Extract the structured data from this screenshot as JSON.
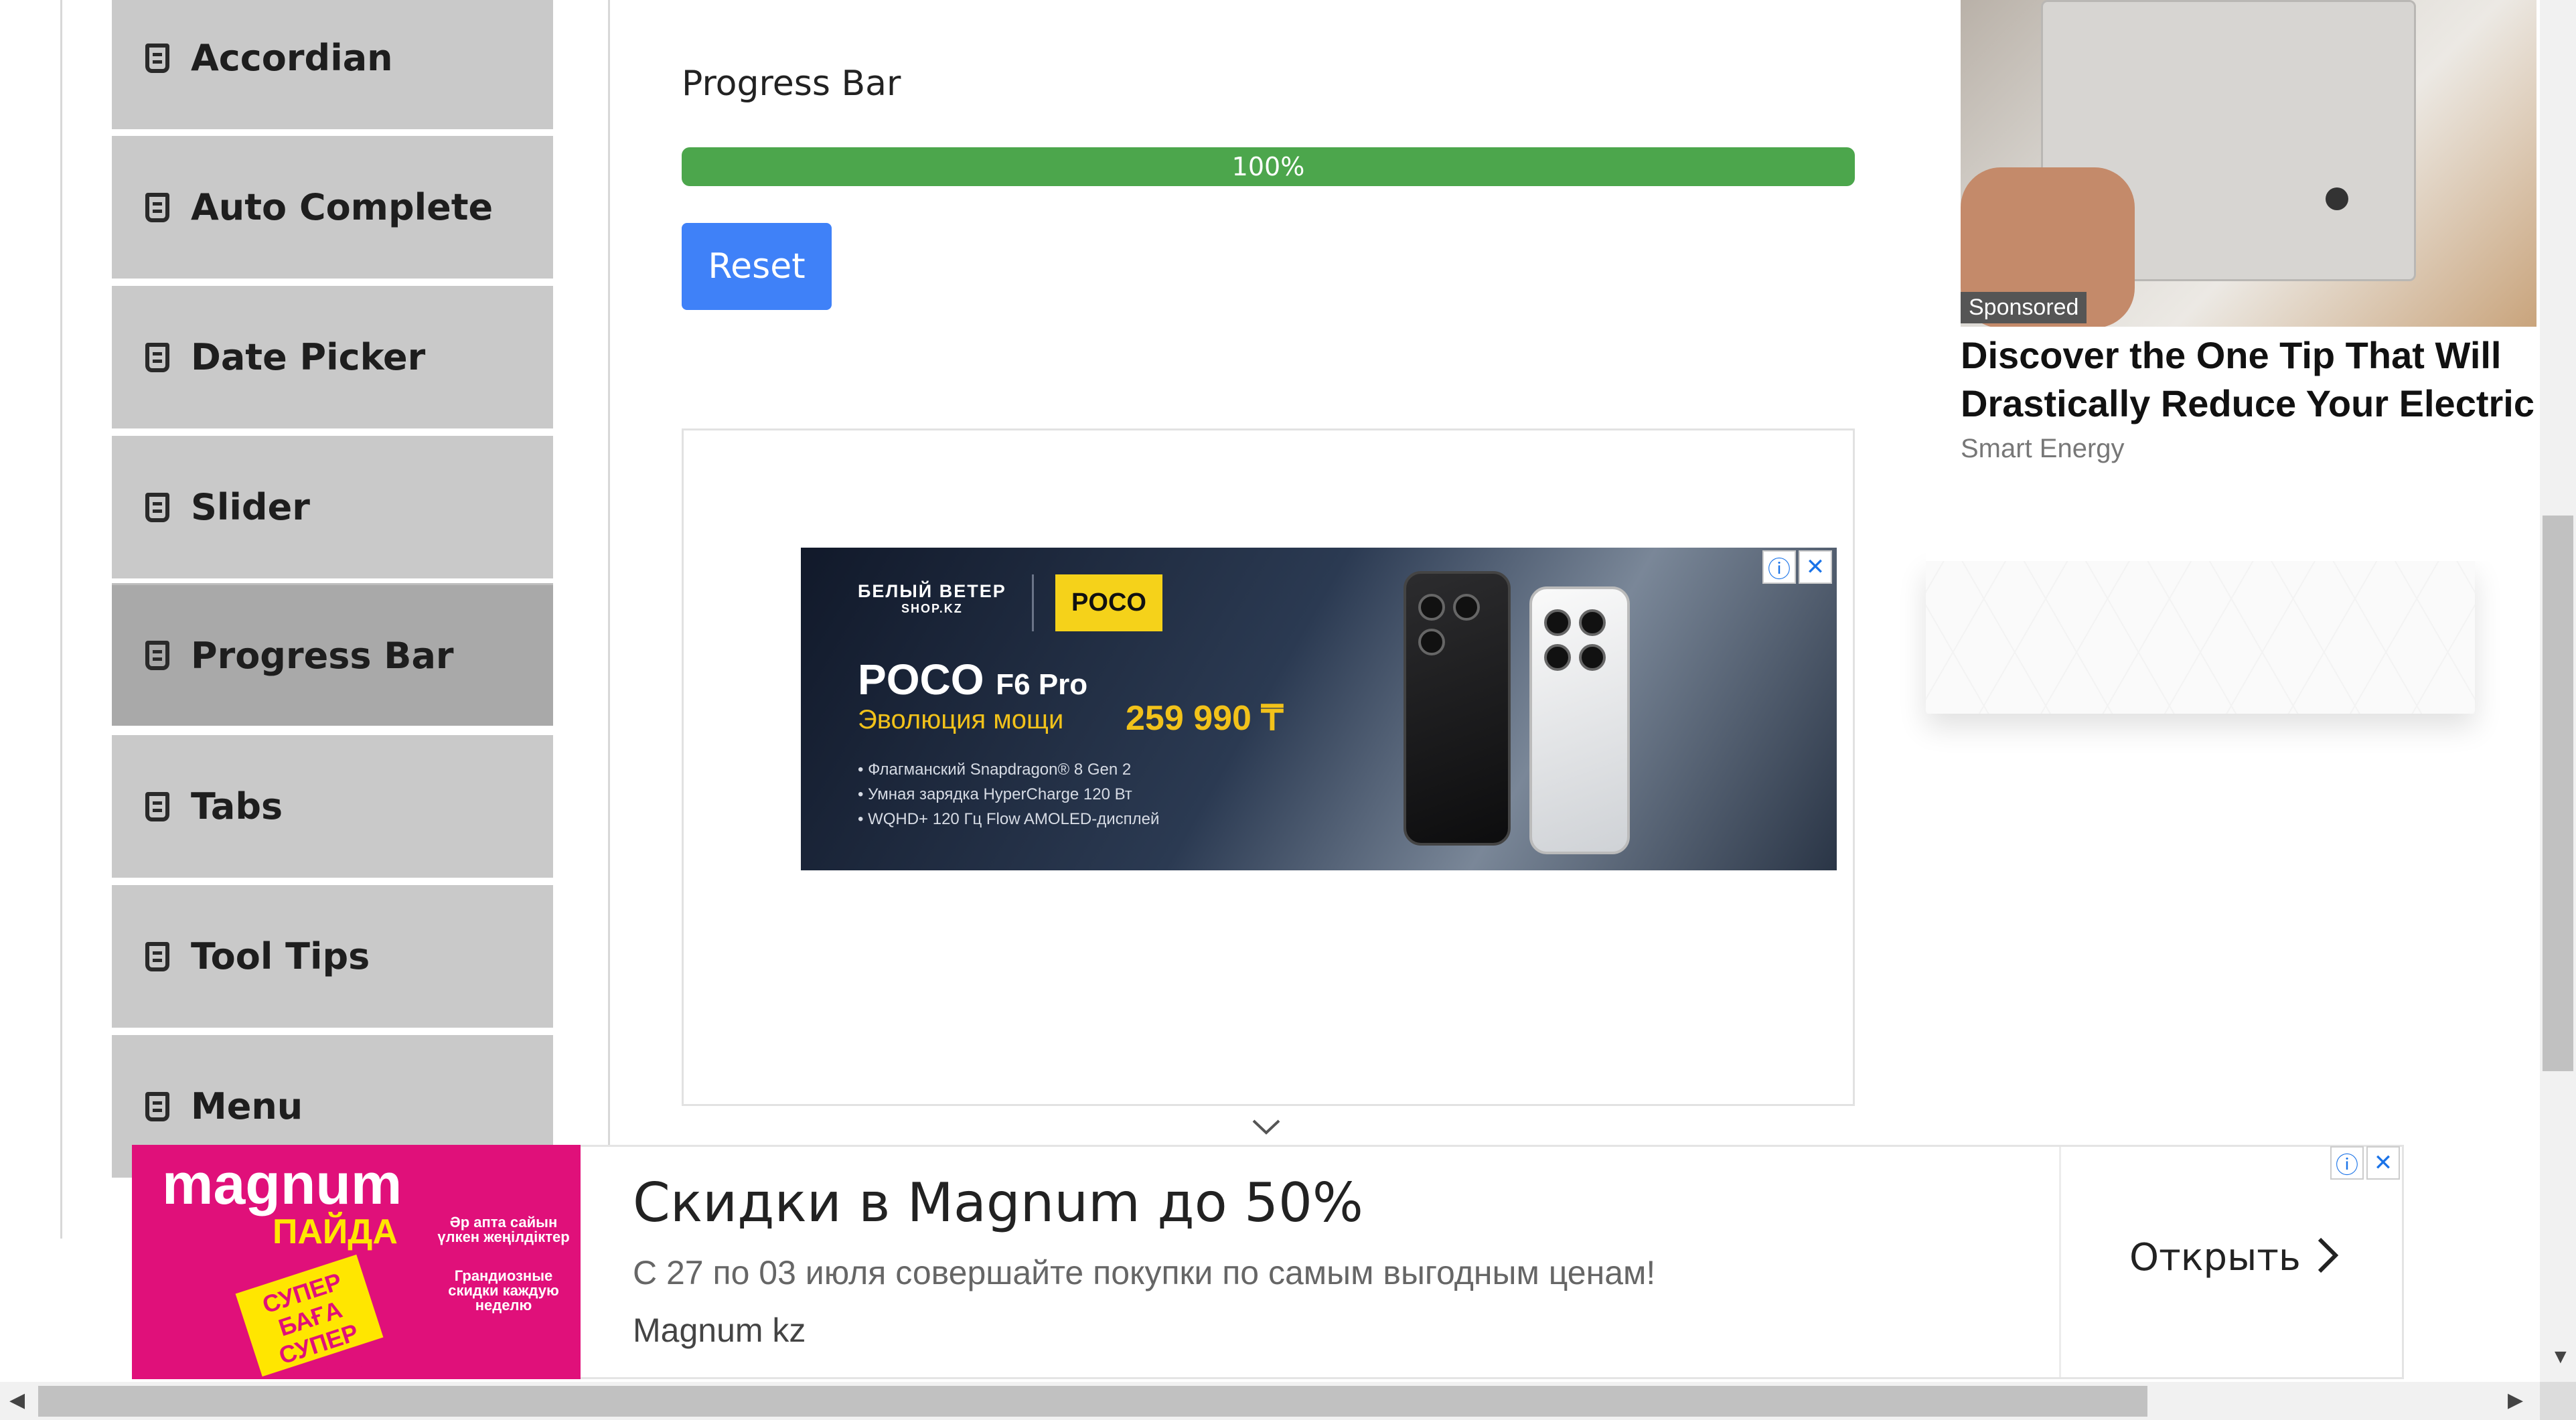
{
  "sidebar": {
    "items": [
      {
        "label": "Accordian",
        "active": false
      },
      {
        "label": "Auto Complete",
        "active": false
      },
      {
        "label": "Date Picker",
        "active": false
      },
      {
        "label": "Slider",
        "active": false
      },
      {
        "label": "Progress Bar",
        "active": true
      },
      {
        "label": "Tabs",
        "active": false
      },
      {
        "label": "Tool Tips",
        "active": false
      },
      {
        "label": "Menu",
        "active": false
      }
    ]
  },
  "main": {
    "title": "Progress Bar",
    "progress": {
      "value": 1.0,
      "label": "100%"
    },
    "reset_label": "Reset"
  },
  "banner_ad": {
    "brand": "БЕЛЫЙ ВЕТЕР",
    "brand_site": "SHOP.KZ",
    "partner": "POCO",
    "model": "POCO",
    "model_suffix": "F6 Pro",
    "tagline": "Эволюция мощи",
    "price": "259 990 ₸",
    "features": [
      "• Флагманский Snapdragon® 8 Gen 2",
      "• Умная зарядка HyperCharge 120 Вт",
      "• WQHD+ 120 Гц Flow AMOLED-дисплей"
    ],
    "info_icon": "ⓘ",
    "close_icon": "✕"
  },
  "sponsored_card": {
    "badge": "Sponsored",
    "headline": "Discover the One Tip That Will Drastically Reduce Your Electric",
    "source": "Smart Energy"
  },
  "bottom_ad": {
    "logo_name": "magnum",
    "logo_sub": "ПАЙДА",
    "logo_tag": "СУПЕР БАҒА СУПЕР ЦЕНА",
    "logo_kz": "Әр апта сайын үлкен жеңілдіктер",
    "logo_ru": "Грандиозные скидки каждую неделю",
    "headline": "Скидки в Magnum до 50%",
    "description": "С 27 по 03 июля совершайте покупки по самым выгодным ценам!",
    "source": "Magnum kz",
    "cta": "Открыть",
    "info_icon": "ⓘ",
    "close_icon": "✕"
  },
  "colors": {
    "progress": "#4ca64c",
    "button": "#3f81f8",
    "sidebar_item": "#c9c9c9",
    "sidebar_active": "#a9a9a9",
    "magnum": "#e0107a"
  }
}
